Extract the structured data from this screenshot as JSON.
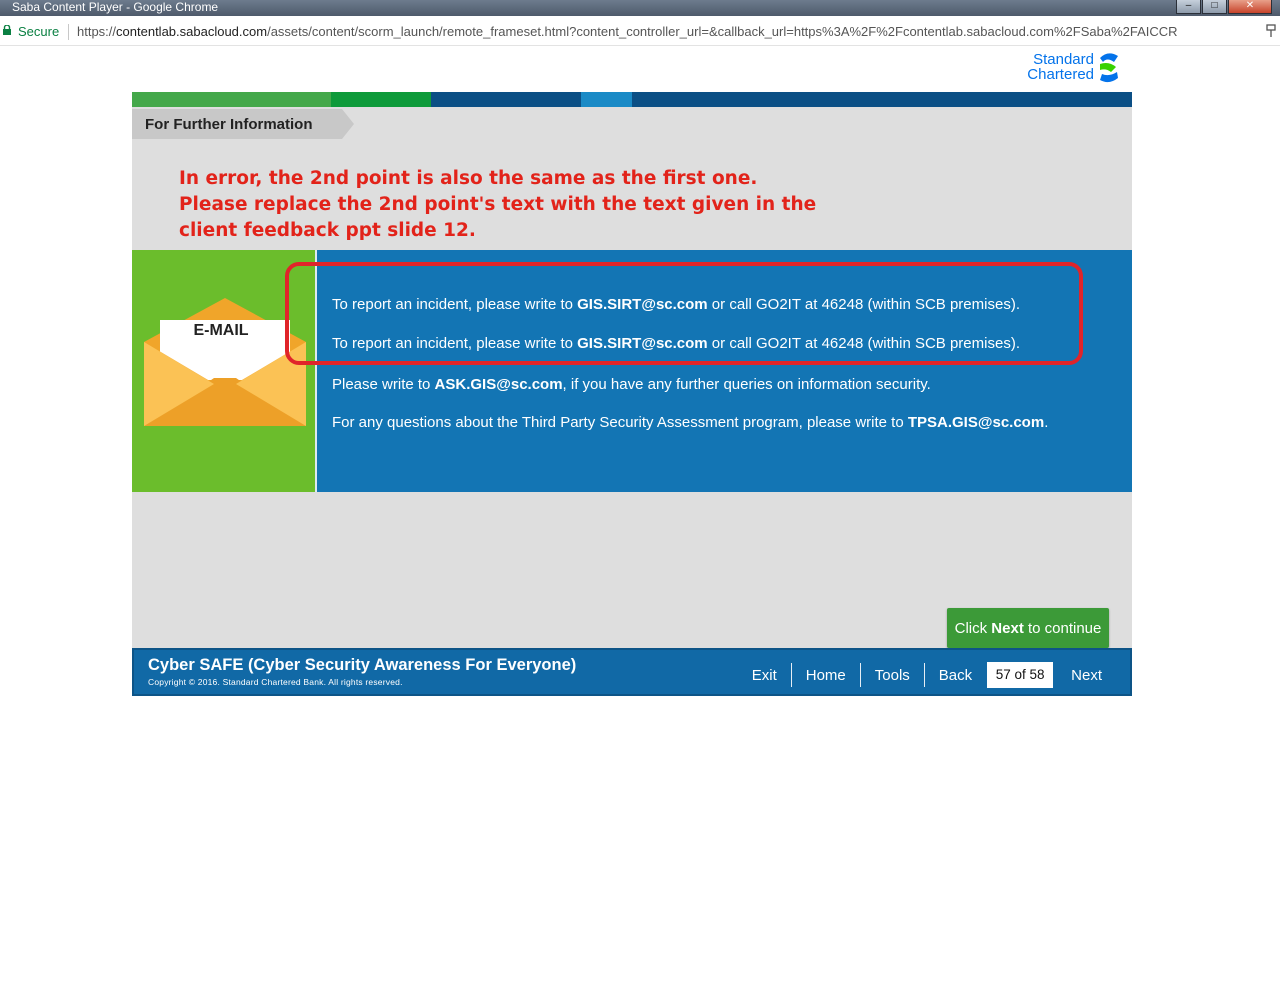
{
  "window": {
    "title": "Saba Content Player - Google Chrome",
    "minimize": "–",
    "maximize": "□",
    "close": "✕"
  },
  "address_bar": {
    "secure_label": "Secure",
    "url_scheme": "https://",
    "url_domain": "contentlab.sabacloud.com",
    "url_path": "/assets/content/scorm_launch/remote_frameset.html?content_controller_url=&callback_url=https%3A%2F%2Fcontentlab.sabacloud.com%2FSaba%2FAICCR",
    "right_icon": "pin-icon"
  },
  "brand": {
    "line1": "Standard",
    "line2": "Chartered",
    "green": "#38d200",
    "blue": "#0473ea"
  },
  "header": {
    "section_title": "For Further Information"
  },
  "review_note": {
    "lines": [
      "In error, the 2nd point is also the same as the first one.",
      "Please replace the 2nd point's text with the text given in the",
      "client feedback ppt slide 12."
    ],
    "color": "#e2231a"
  },
  "email_card": {
    "label": "E-MAIL",
    "icon": "envelope-icon"
  },
  "info": {
    "line1": {
      "pre": "To report an incident, please write to ",
      "bold": "GIS.SIRT@sc.com",
      "post": " or call GO2IT at 46248 (within SCB premises)."
    },
    "line2": {
      "pre": "To report an incident, please write to ",
      "bold": "GIS.SIRT@sc.com",
      "post": " or call GO2IT at 46248 (within SCB premises)."
    },
    "line3": {
      "pre": "Please write to ",
      "bold": "ASK.GIS@sc.com",
      "post": ", if you have any further queries on information security."
    },
    "line4": {
      "pre": "For any questions about the Third Party Security Assessment program, please write to ",
      "bold": "TPSA.GIS@sc.com",
      "post": "."
    }
  },
  "tooltip": {
    "pre": "Click ",
    "bold": "Next",
    "post": " to continue"
  },
  "footer": {
    "course_title": "Cyber SAFE (Cyber Security Awareness For Everyone)",
    "copyright": "Copyright © 2016. Standard Chartered Bank. All rights reserved.",
    "nav": {
      "exit": "Exit",
      "home": "Home",
      "tools": "Tools",
      "back": "Back",
      "page_counter": "57 of 58",
      "next": "Next"
    }
  },
  "colors": {
    "panel_blue": "#1375b4",
    "panel_green": "#6bbd2c",
    "footer_blue": "#1169a6",
    "highlight_red": "#e0242a",
    "tooltip_green": "#3c9a38",
    "stripes": [
      "#44a84a",
      "#0e9a3a",
      "#0b4f85",
      "#1a8ac6",
      "#0b4f85"
    ]
  }
}
